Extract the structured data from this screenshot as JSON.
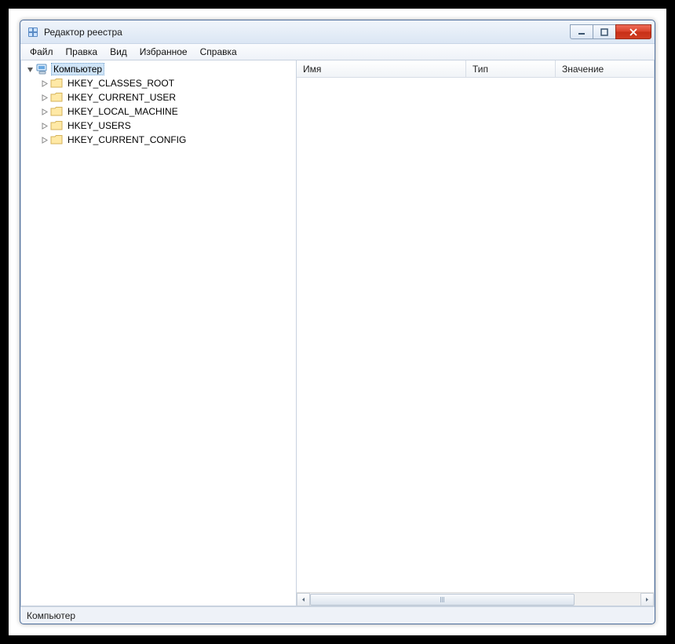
{
  "window": {
    "title": "Редактор реестра"
  },
  "menu": {
    "items": [
      "Файл",
      "Правка",
      "Вид",
      "Избранное",
      "Справка"
    ]
  },
  "tree": {
    "root": {
      "label": "Компьютер",
      "expanded": true,
      "selected": true,
      "children": [
        {
          "label": "HKEY_CLASSES_ROOT"
        },
        {
          "label": "HKEY_CURRENT_USER"
        },
        {
          "label": "HKEY_LOCAL_MACHINE"
        },
        {
          "label": "HKEY_USERS"
        },
        {
          "label": "HKEY_CURRENT_CONFIG"
        }
      ]
    }
  },
  "list": {
    "columns": {
      "name": "Имя",
      "type": "Тип",
      "value": "Значение"
    },
    "rows": []
  },
  "status": {
    "path": "Компьютер"
  }
}
